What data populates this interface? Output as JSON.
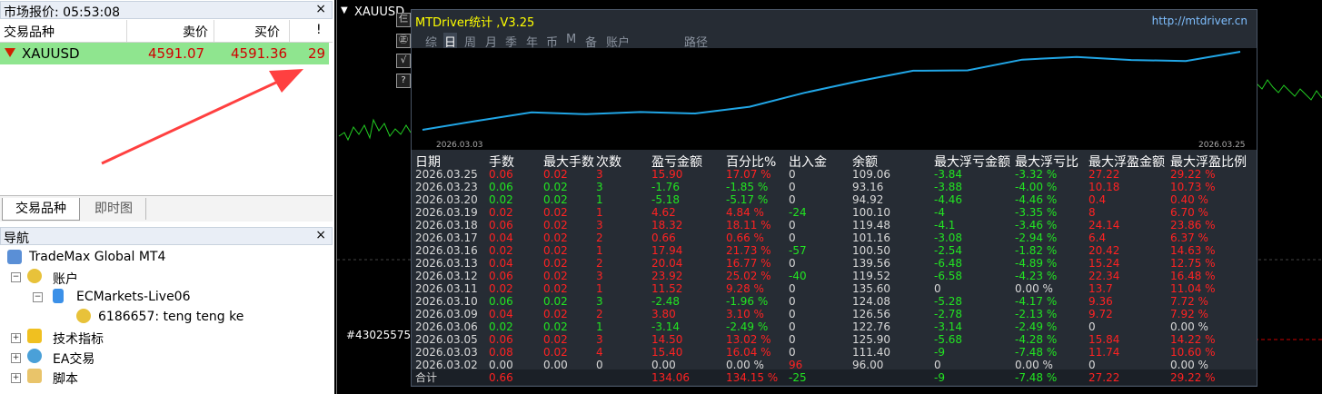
{
  "market_watch": {
    "title": "市场报价: 05:53:08",
    "columns": [
      "交易品种",
      "卖价",
      "买价",
      "!"
    ],
    "row": {
      "symbol": "XAUUSD",
      "bid": "4591.07",
      "ask": "4591.36",
      "spread": "29"
    },
    "tabs": [
      "交易品种",
      "即时图"
    ]
  },
  "navigator": {
    "title": "导航",
    "tree": {
      "root": "TradeMax Global MT4",
      "accounts": "账户",
      "server": "ECMarkets-Live06",
      "account": "6186657: teng teng ke",
      "indicators": "技术指标",
      "ea": "EA交易",
      "scripts": "脚本"
    }
  },
  "chart": {
    "symbol_label": "XAUUSD",
    "order_label": "#43025575",
    "side_buttons": [
      "仨",
      "㊣",
      "√",
      "?"
    ]
  },
  "mtdriver": {
    "title": "MTDriver统计 ,V3.25",
    "url": "http://mtdriver.cn",
    "tabs": [
      "综",
      "日",
      "周",
      "月",
      "季",
      "年",
      "币",
      "M",
      "备",
      "账户",
      "路径"
    ],
    "selected_tab": "日",
    "equity_curve": {
      "start_label": "2026.03.03",
      "end_label": "2026.03.25",
      "values": [
        96.0,
        111.4,
        125.9,
        122.76,
        126.56,
        124.08,
        135.6,
        119.52,
        139.56,
        100.5,
        101.16,
        119.48,
        100.1,
        94.92,
        93.16,
        109.06
      ]
    },
    "headers": [
      "日期",
      "手数",
      "最大手数",
      "次数",
      "盈亏金额",
      "百分比%",
      "出入金",
      "余额",
      "最大浮亏金额",
      "最大浮亏比",
      "最大浮盈金额",
      "最大浮盈比例"
    ],
    "rows": [
      [
        "2026.03.25",
        "0.06",
        "0.02",
        "3",
        "15.90",
        "17.07 %",
        "0",
        "109.06",
        "-3.84",
        "-3.32 %",
        "27.22",
        "29.22 %"
      ],
      [
        "2026.03.23",
        "0.06",
        "0.02",
        "3",
        "-1.76",
        "-1.85 %",
        "0",
        "93.16",
        "-3.88",
        "-4.00 %",
        "10.18",
        "10.73 %"
      ],
      [
        "2026.03.20",
        "0.02",
        "0.02",
        "1",
        "-5.18",
        "-5.17 %",
        "0",
        "94.92",
        "-4.46",
        "-4.46 %",
        "0.4",
        "0.40 %"
      ],
      [
        "2026.03.19",
        "0.02",
        "0.02",
        "1",
        "4.62",
        "4.84 %",
        "-24",
        "100.10",
        "-4",
        "-3.35 %",
        "8",
        "6.70 %"
      ],
      [
        "2026.03.18",
        "0.06",
        "0.02",
        "3",
        "18.32",
        "18.11 %",
        "0",
        "119.48",
        "-4.1",
        "-3.46 %",
        "24.14",
        "23.86 %"
      ],
      [
        "2026.03.17",
        "0.04",
        "0.02",
        "2",
        "0.66",
        "0.66 %",
        "0",
        "101.16",
        "-3.08",
        "-2.94 %",
        "6.4",
        "6.37 %"
      ],
      [
        "2026.03.16",
        "0.02",
        "0.02",
        "1",
        "17.94",
        "21.73 %",
        "-57",
        "100.50",
        "-2.54",
        "-1.82 %",
        "20.42",
        "14.63 %"
      ],
      [
        "2026.03.13",
        "0.04",
        "0.02",
        "2",
        "20.04",
        "16.77 %",
        "0",
        "139.56",
        "-6.48",
        "-4.89 %",
        "15.24",
        "12.75 %"
      ],
      [
        "2026.03.12",
        "0.06",
        "0.02",
        "3",
        "23.92",
        "25.02 %",
        "-40",
        "119.52",
        "-6.58",
        "-4.23 %",
        "22.34",
        "16.48 %"
      ],
      [
        "2026.03.11",
        "0.02",
        "0.02",
        "1",
        "11.52",
        "9.28 %",
        "0",
        "135.60",
        "0",
        "0.00 %",
        "13.7",
        "11.04 %"
      ],
      [
        "2026.03.10",
        "0.06",
        "0.02",
        "3",
        "-2.48",
        "-1.96 %",
        "0",
        "124.08",
        "-5.28",
        "-4.17 %",
        "9.36",
        "7.72 %"
      ],
      [
        "2026.03.09",
        "0.04",
        "0.02",
        "2",
        "3.80",
        "3.10 %",
        "0",
        "126.56",
        "-2.78",
        "-2.13 %",
        "9.72",
        "7.92 %"
      ],
      [
        "2026.03.06",
        "0.02",
        "0.02",
        "1",
        "-3.14",
        "-2.49 %",
        "0",
        "122.76",
        "-3.14",
        "-2.49 %",
        "0",
        "0.00 %"
      ],
      [
        "2026.03.05",
        "0.06",
        "0.02",
        "3",
        "14.50",
        "13.02 %",
        "0",
        "125.90",
        "-5.68",
        "-4.28 %",
        "15.84",
        "14.22 %"
      ],
      [
        "2026.03.03",
        "0.08",
        "0.02",
        "4",
        "15.40",
        "16.04 %",
        "0",
        "111.40",
        "-9",
        "-7.48 %",
        "11.74",
        "10.60 %"
      ],
      [
        "2026.03.02",
        "0.00",
        "0.00",
        "0",
        "0.00",
        "0.00 %",
        "96",
        "96.00",
        "0",
        "0.00 %",
        "0",
        "0.00 %"
      ]
    ],
    "total": [
      "合计",
      "0.66",
      "",
      "",
      "134.06",
      "134.15 %",
      "-25",
      "",
      "-9",
      "-7.48 %",
      "27.22",
      "29.22 %"
    ]
  },
  "colors": {
    "positive": "#22e522",
    "negative": "#ff2222",
    "title": "#ffff00",
    "market_row": "#8fe58f"
  }
}
